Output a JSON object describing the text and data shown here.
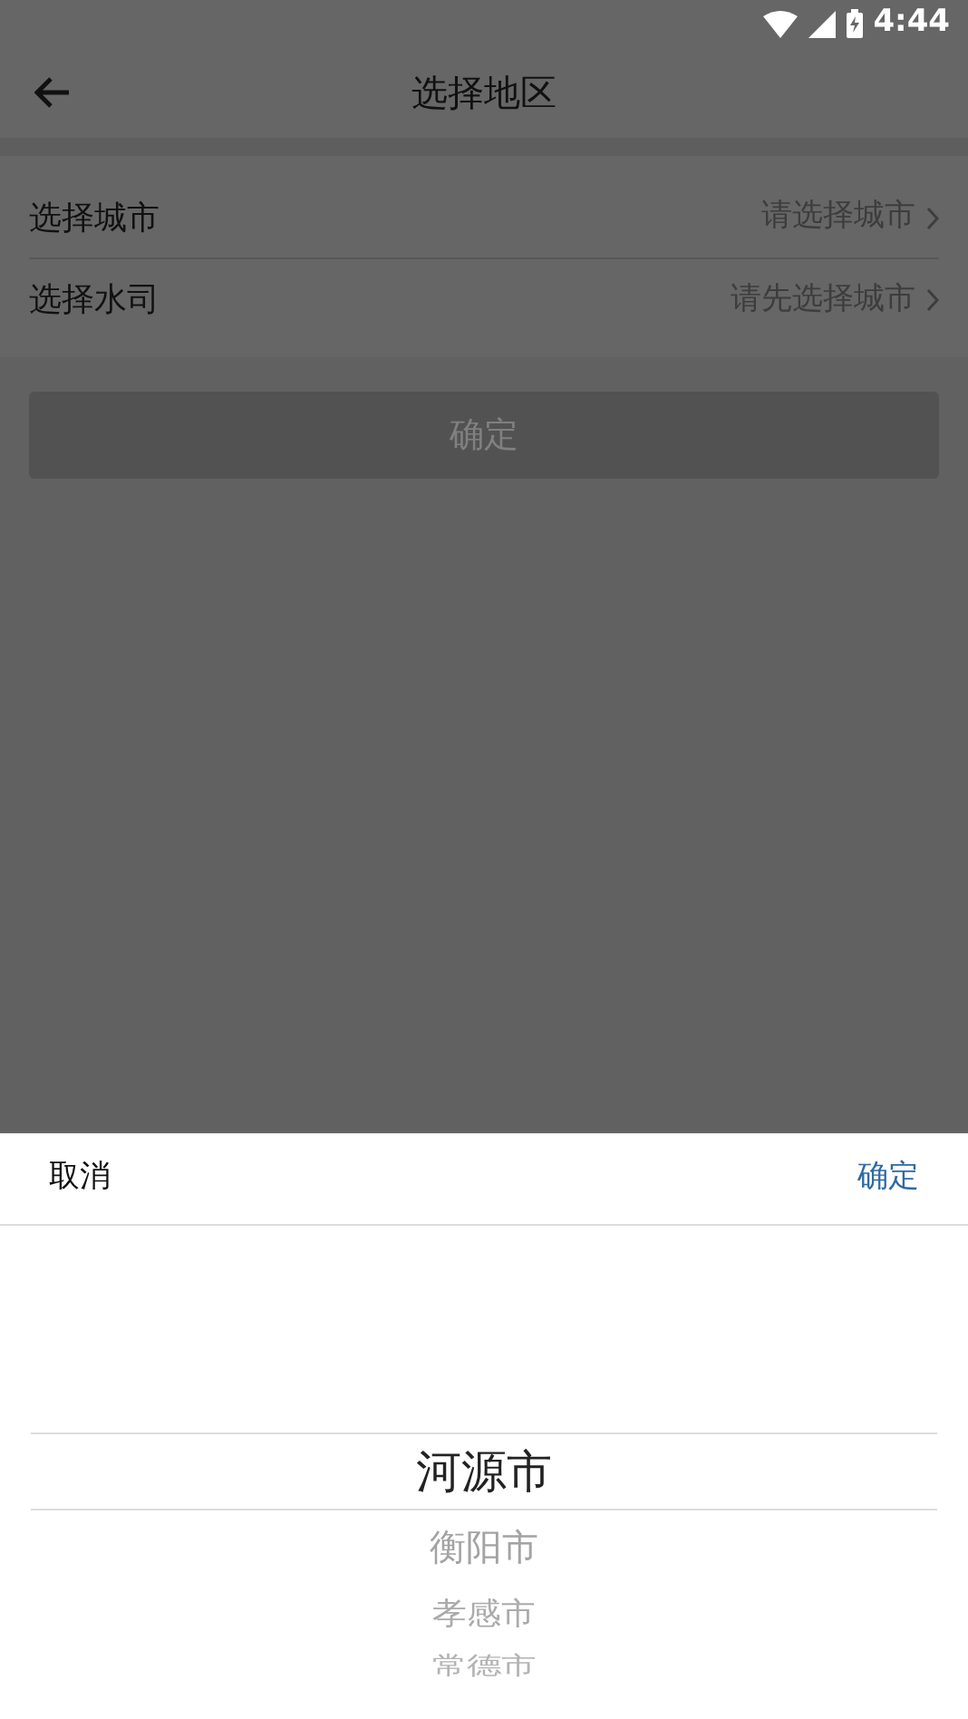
{
  "status_bar": {
    "time": "4:44"
  },
  "header": {
    "title": "选择地区"
  },
  "form_rows": [
    {
      "label": "选择城市",
      "value": "请选择城市"
    },
    {
      "label": "选择水司",
      "value": "请先选择城市"
    }
  ],
  "confirm_button": {
    "label": "确定",
    "disabled": true
  },
  "picker": {
    "cancel": "取消",
    "confirm": "确定",
    "options": [
      {
        "label": "河源市",
        "selected": true
      },
      {
        "label": "衡阳市",
        "selected": false
      },
      {
        "label": "孝感市",
        "selected": false
      },
      {
        "label": "常德市",
        "selected": false
      }
    ]
  }
}
